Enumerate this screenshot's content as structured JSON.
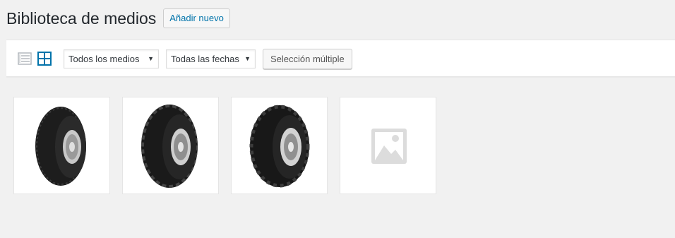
{
  "header": {
    "title": "Biblioteca de medios",
    "add_new_label": "Añadir nuevo"
  },
  "toolbar": {
    "view_list_icon": "list-view-icon",
    "view_grid_icon": "grid-view-icon",
    "filter_type": {
      "selected": "Todos los medios"
    },
    "filter_date": {
      "selected": "Todas las fechas"
    },
    "bulk_select_label": "Selección múltiple"
  },
  "colors": {
    "accent": "#0073aa",
    "background": "#f1f1f1",
    "tile_bg": "#ffffff",
    "placeholder_icon": "#dcdcdc"
  },
  "attachments": [
    {
      "type": "image",
      "icon": "tire-image-1"
    },
    {
      "type": "image",
      "icon": "tire-image-2"
    },
    {
      "type": "image",
      "icon": "tire-image-3"
    },
    {
      "type": "placeholder",
      "icon": "image-placeholder-icon"
    }
  ]
}
